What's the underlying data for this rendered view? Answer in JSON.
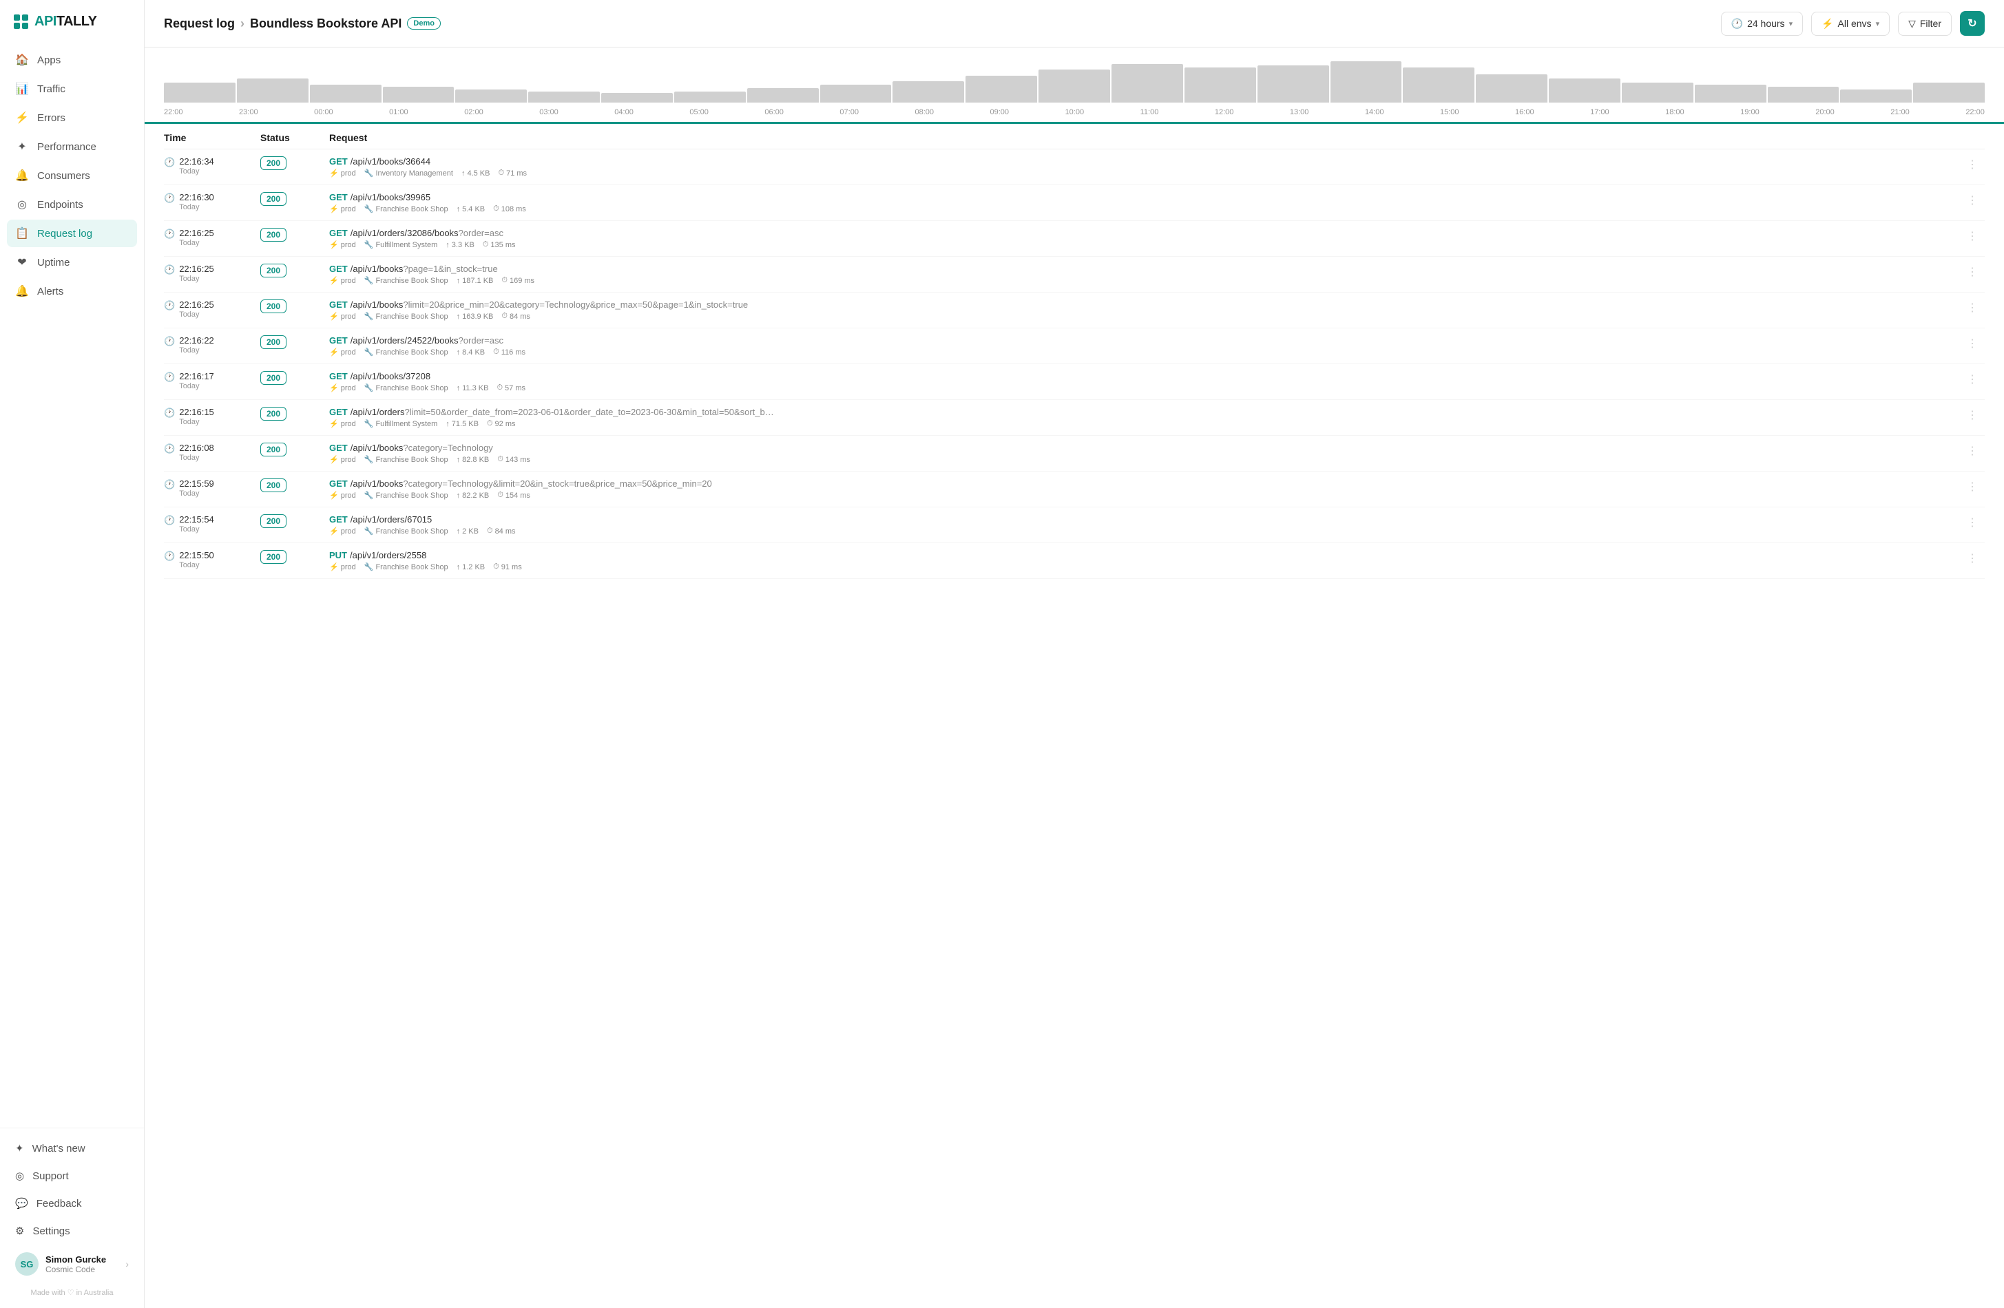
{
  "sidebar": {
    "logo": {
      "api": "API",
      "tally": "TALLY"
    },
    "nav": [
      {
        "id": "apps",
        "label": "Apps",
        "icon": "🏠"
      },
      {
        "id": "traffic",
        "label": "Traffic",
        "icon": "📊"
      },
      {
        "id": "errors",
        "label": "Errors",
        "icon": "⚡"
      },
      {
        "id": "performance",
        "label": "Performance",
        "icon": "✦"
      },
      {
        "id": "consumers",
        "label": "Consumers",
        "icon": "🔔"
      },
      {
        "id": "endpoints",
        "label": "Endpoints",
        "icon": "◎"
      },
      {
        "id": "request-log",
        "label": "Request log",
        "icon": "📋",
        "active": true
      }
    ],
    "uptime": {
      "label": "Uptime",
      "icon": "❤"
    },
    "alerts": {
      "label": "Alerts",
      "icon": "🔔"
    },
    "bottom": [
      {
        "id": "whats-new",
        "label": "What's new",
        "icon": "✦"
      },
      {
        "id": "support",
        "label": "Support",
        "icon": "◎"
      },
      {
        "id": "feedback",
        "label": "Feedback",
        "icon": "💬"
      },
      {
        "id": "settings",
        "label": "Settings",
        "icon": "⚙"
      }
    ],
    "user": {
      "name": "Simon Gurcke",
      "company": "Cosmic Code",
      "initials": "SG"
    },
    "made_with": "Made with ♡ in Australia"
  },
  "header": {
    "breadcrumb_page": "Request log",
    "separator": "›",
    "api_name": "Boundless Bookstore API",
    "demo_label": "Demo",
    "time_range": "24 hours",
    "env_label": "All envs",
    "filter_label": "Filter"
  },
  "chart": {
    "time_labels": [
      "22:00",
      "23:00",
      "00:00",
      "01:00",
      "02:00",
      "03:00",
      "04:00",
      "05:00",
      "06:00",
      "07:00",
      "08:00",
      "09:00",
      "10:00",
      "11:00",
      "12:00",
      "13:00",
      "14:00",
      "15:00",
      "16:00",
      "17:00",
      "18:00",
      "19:00",
      "20:00",
      "21:00",
      "22:00"
    ],
    "bar_heights": [
      20,
      25,
      18,
      15,
      12,
      10,
      8,
      10,
      14,
      18,
      22,
      28,
      35,
      42,
      38,
      40,
      45,
      38,
      30,
      25,
      20,
      18,
      15,
      12,
      20
    ]
  },
  "table": {
    "columns": [
      "Time",
      "Status",
      "Request"
    ],
    "rows": [
      {
        "time": "22:16:34",
        "time_sub": "Today",
        "status": "200",
        "method": "GET",
        "path": "/api/v1/books/36644",
        "params": "",
        "env": "prod",
        "consumer": "Inventory Management",
        "size": "4.5 KB",
        "duration": "71 ms"
      },
      {
        "time": "22:16:30",
        "time_sub": "Today",
        "status": "200",
        "method": "GET",
        "path": "/api/v1/books/39965",
        "params": "",
        "env": "prod",
        "consumer": "Franchise Book Shop",
        "size": "5.4 KB",
        "duration": "108 ms"
      },
      {
        "time": "22:16:25",
        "time_sub": "Today",
        "status": "200",
        "method": "GET",
        "path": "/api/v1/orders/32086/books",
        "params": "?order=asc",
        "env": "prod",
        "consumer": "Fulfillment System",
        "size": "3.3 KB",
        "duration": "135 ms"
      },
      {
        "time": "22:16:25",
        "time_sub": "Today",
        "status": "200",
        "method": "GET",
        "path": "/api/v1/books",
        "params": "?page=1&in_stock=true",
        "env": "prod",
        "consumer": "Franchise Book Shop",
        "size": "187.1 KB",
        "duration": "169 ms"
      },
      {
        "time": "22:16:25",
        "time_sub": "Today",
        "status": "200",
        "method": "GET",
        "path": "/api/v1/books",
        "params": "?limit=20&price_min=20&category=Technology&price_max=50&page=1&in_stock=true",
        "env": "prod",
        "consumer": "Franchise Book Shop",
        "size": "163.9 KB",
        "duration": "84 ms"
      },
      {
        "time": "22:16:22",
        "time_sub": "Today",
        "status": "200",
        "method": "GET",
        "path": "/api/v1/orders/24522/books",
        "params": "?order=asc",
        "env": "prod",
        "consumer": "Franchise Book Shop",
        "size": "8.4 KB",
        "duration": "116 ms"
      },
      {
        "time": "22:16:17",
        "time_sub": "Today",
        "status": "200",
        "method": "GET",
        "path": "/api/v1/books/37208",
        "params": "",
        "env": "prod",
        "consumer": "Franchise Book Shop",
        "size": "11.3 KB",
        "duration": "57 ms"
      },
      {
        "time": "22:16:15",
        "time_sub": "Today",
        "status": "200",
        "method": "GET",
        "path": "/api/v1/orders",
        "params": "?limit=50&order_date_from=2023-06-01&order_date_to=2023-06-30&min_total=50&sort_b…",
        "env": "prod",
        "consumer": "Fulfillment System",
        "size": "71.5 KB",
        "duration": "92 ms"
      },
      {
        "time": "22:16:08",
        "time_sub": "Today",
        "status": "200",
        "method": "GET",
        "path": "/api/v1/books",
        "params": "?category=Technology",
        "env": "prod",
        "consumer": "Franchise Book Shop",
        "size": "82.8 KB",
        "duration": "143 ms"
      },
      {
        "time": "22:15:59",
        "time_sub": "Today",
        "status": "200",
        "method": "GET",
        "path": "/api/v1/books",
        "params": "?category=Technology&limit=20&in_stock=true&price_max=50&price_min=20",
        "env": "prod",
        "consumer": "Franchise Book Shop",
        "size": "82.2 KB",
        "duration": "154 ms"
      },
      {
        "time": "22:15:54",
        "time_sub": "Today",
        "status": "200",
        "method": "GET",
        "path": "/api/v1/orders/67015",
        "params": "",
        "env": "prod",
        "consumer": "Franchise Book Shop",
        "size": "2 KB",
        "duration": "84 ms"
      },
      {
        "time": "22:15:50",
        "time_sub": "Today",
        "status": "200",
        "method": "PUT",
        "path": "/api/v1/orders/2558",
        "params": "",
        "env": "prod",
        "consumer": "Franchise Book Shop",
        "size": "1.2 KB",
        "duration": "91 ms"
      }
    ]
  }
}
